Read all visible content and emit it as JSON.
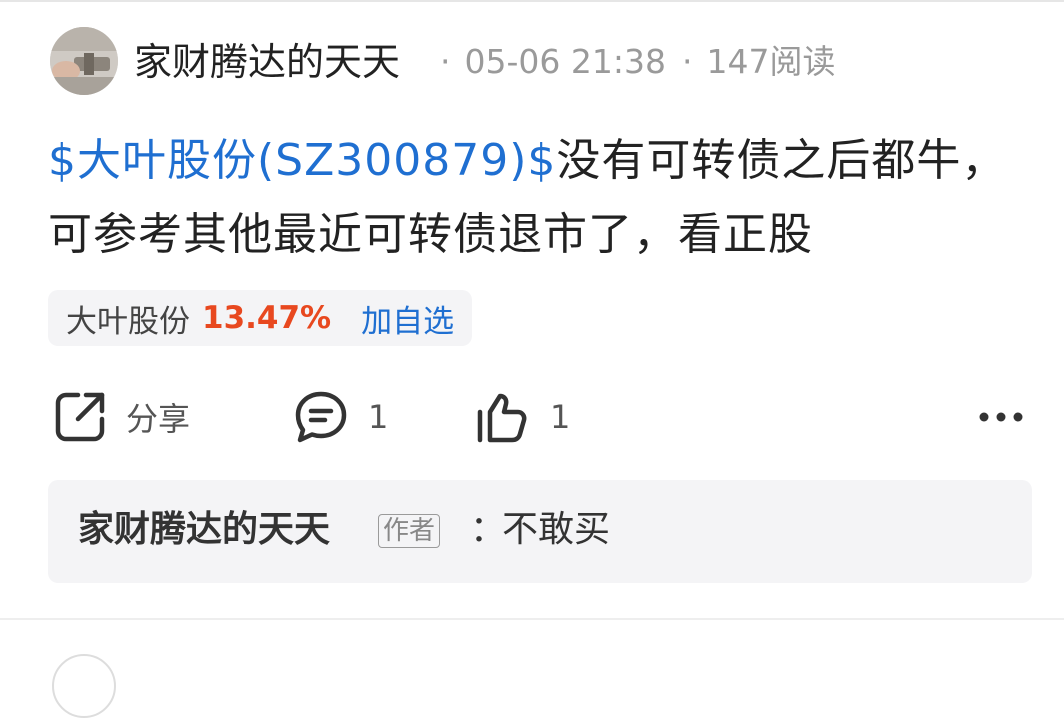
{
  "post": {
    "author": "家财腾达的天天",
    "timestamp": "05-06 21:38",
    "reads": "147阅读",
    "stock_link": "$大叶股份(SZ300879)$",
    "text": "没有可转债之后都牛，可参考其他最近可转债退市了，看正股"
  },
  "stock_chip": {
    "name": "大叶股份",
    "change": "13.47%",
    "add_label": "加自选",
    "change_color": "#e8481f"
  },
  "actions": {
    "share_label": "分享",
    "comment_count": "1",
    "like_count": "1",
    "share_icon": "share-icon",
    "comment_icon": "comment-icon",
    "like_icon": "thumbs-up-icon",
    "more_icon": "more-icon"
  },
  "reply": {
    "author": "家财腾达的天天",
    "tag": "作者",
    "colon": "：",
    "text": "不敢买"
  },
  "colors": {
    "link": "#1f6fd1",
    "reply_bg": "#f4f4f6"
  }
}
